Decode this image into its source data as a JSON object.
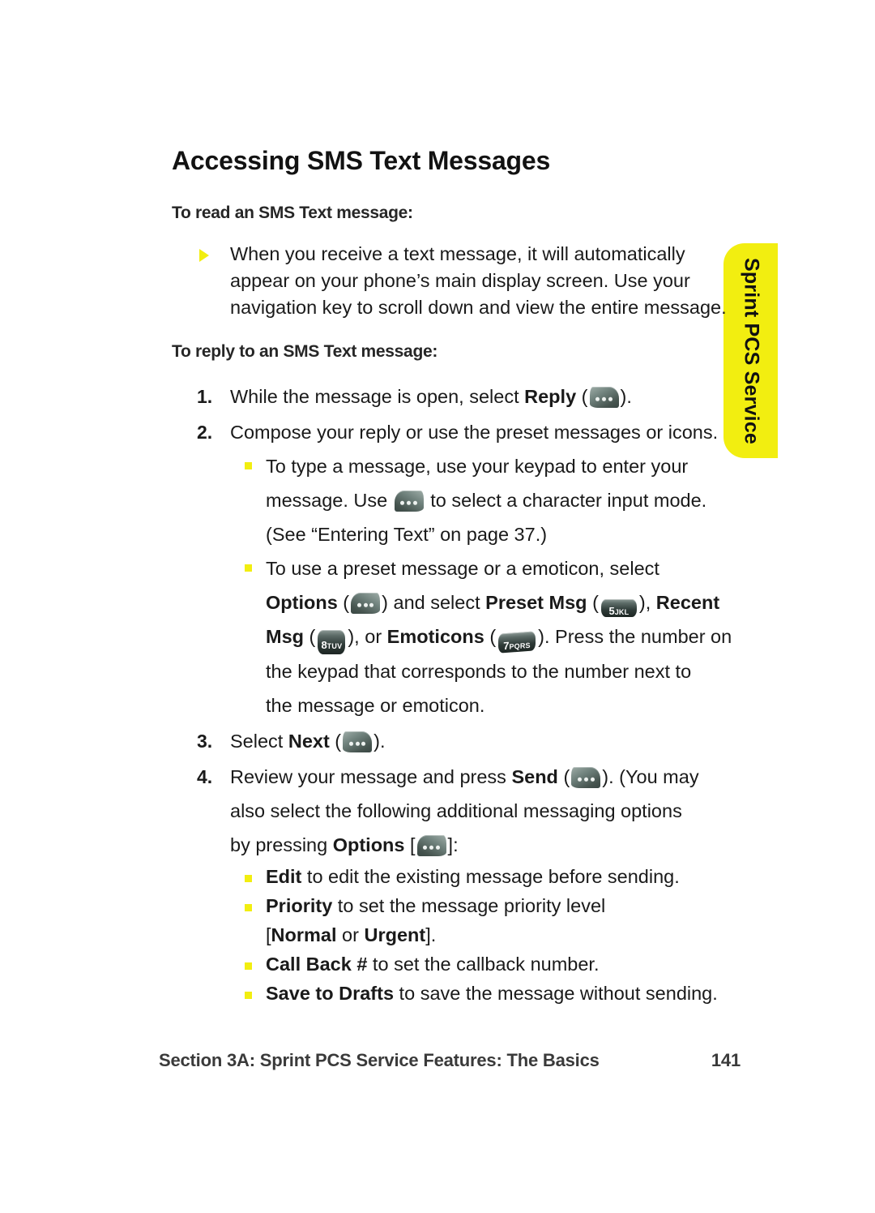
{
  "page": {
    "title": "Accessing SMS Text Messages",
    "accent_yellow": "#F2EE10",
    "text_color": "#1a1a1a"
  },
  "side_tab": {
    "label": "Sprint PCS Service",
    "color": "#F2EE10"
  },
  "section_read": {
    "heading": "To read an SMS Text message:",
    "bullet": "When you receive a text message, it will automatically appear on your phone’s main display screen. Use your navigation key to scroll down and view the entire message."
  },
  "section_reply": {
    "heading": "To reply to an SMS Text message:",
    "steps": [
      {
        "number": "1.",
        "pre": "While the message is open, select ",
        "bold": "Reply",
        "open_paren": " (",
        "icon": "softkey-left-icon",
        "post": ")."
      },
      {
        "number": "2.",
        "text": "Compose your reply or use the preset messages or icons."
      },
      {
        "number": "3.",
        "pre": "Select ",
        "bold": "Next",
        "open_paren": " (",
        "icon": "softkey-left-icon",
        "post": ")."
      },
      {
        "number": "4.",
        "line1_pre": "Review your message and press ",
        "line1_bold": "Send",
        "line1_open": " (",
        "line1_icon": "softkey-left-icon",
        "line1_post": "). (You may",
        "line2": "also select the following additional messaging options",
        "line3_pre": "by pressing ",
        "line3_bold": "Options",
        "line3_open": " [",
        "line3_icon": "softkey-right-icon",
        "line3_post": "]:"
      }
    ],
    "step2_subitems": {
      "a": {
        "line1": "To type a message, use your keypad to enter your",
        "line2_pre": "message. Use ",
        "line2_icon": "softkey-right-icon",
        "line2_post": " to select a character input mode.",
        "line3": "(See “Entering Text” on page 37.)"
      },
      "b": {
        "line1": "To use a preset message or a emoticon, select",
        "line2_bold1": "Options",
        "line2_open1": " (",
        "line2_icon1": "softkey-right-icon",
        "line2_mid1": ") and select ",
        "line2_bold2": "Preset Msg",
        "line2_open2": " (",
        "line2_key2_digit": "5",
        "line2_key2_letters": "JKL",
        "line2_mid2": "), ",
        "line2_bold3": "Recent",
        "line3_bold1": "Msg",
        "line3_open1": " (",
        "line3_key1_digit": "8",
        "line3_key1_letters": "TUV",
        "line3_mid1": "), or ",
        "line3_bold2": "Emoticons",
        "line3_open2": " (",
        "line3_key2_digit": "7",
        "line3_key2_letters": "PQRS",
        "line3_post": "). Press the number on",
        "line4": "the keypad that corresponds to the number next to",
        "line5": "the message or emoticon."
      }
    }
  },
  "options_list": [
    {
      "bold": "Edit",
      "rest": " to edit the existing message before sending."
    },
    {
      "bold": "Priority",
      "rest": " to set the message priority level",
      "line2_open": "[",
      "line2_bold1": "Normal",
      "line2_mid": " or ",
      "line2_bold2": "Urgent",
      "line2_close": "]."
    },
    {
      "bold": "Call Back #",
      "rest": " to set the callback number."
    },
    {
      "bold": "Save to Drafts",
      "rest": " to save the message without sending."
    }
  ],
  "footer": {
    "section": "Section 3A: Sprint PCS Service Features: The Basics",
    "page_number": "141"
  }
}
